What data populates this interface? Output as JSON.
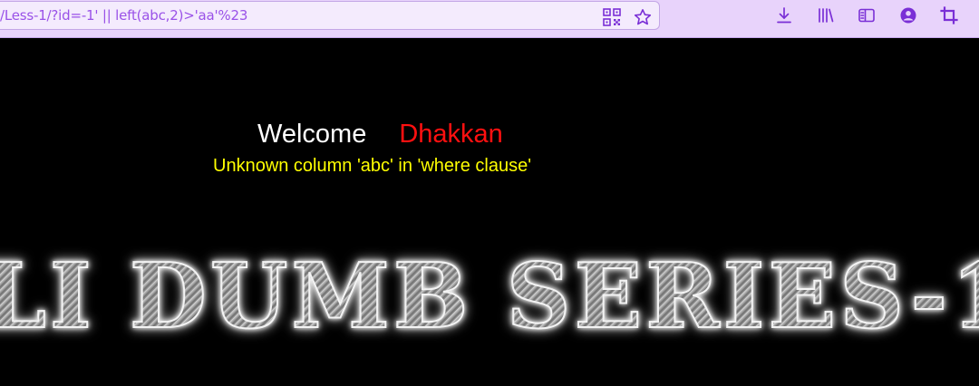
{
  "browser": {
    "url": "/Less-1/?id=-1' || left(abc,2)>'aa'%23",
    "icons": [
      "qr-code-icon",
      "star-icon",
      "download-icon",
      "library-icon",
      "sidebar-icon",
      "account-icon",
      "crop-icon"
    ]
  },
  "page": {
    "welcome_word": "Welcome",
    "welcome_name": "Dhakkan",
    "error_message": "Unknown column 'abc' in 'where clause'",
    "banner_title": "LI DUMB SERIES-1"
  },
  "colors": {
    "toolbar_bg": "#e8d3fb",
    "url_text": "#9a52e8",
    "icon": "#7a2fd6",
    "page_bg": "#000000",
    "welcome": "#ffffff",
    "name": "#ff1010",
    "error": "#ffff00"
  }
}
